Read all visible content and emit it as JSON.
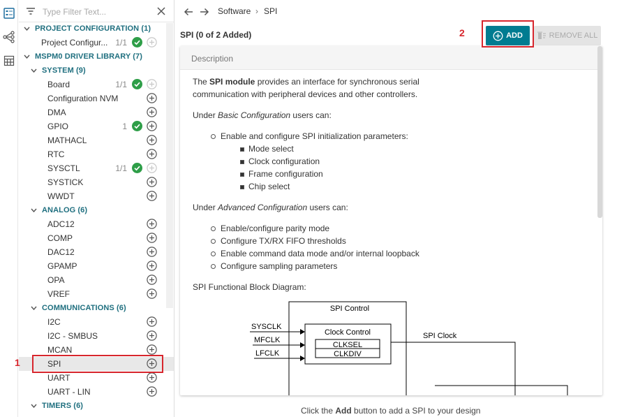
{
  "sidebar": {
    "filter_placeholder": "Type Filter Text...",
    "items": [
      {
        "type": "cat",
        "level": 0,
        "label": "PROJECT CONFIGURATION (1)"
      },
      {
        "type": "item",
        "level": 0,
        "label": "Project Configur...",
        "count": "1/1",
        "check": true,
        "plus_disabled": true
      },
      {
        "type": "cat",
        "level": 0,
        "label": "MSPM0 DRIVER LIBRARY (7)"
      },
      {
        "type": "cat",
        "level": 1,
        "label": "SYSTEM (9)"
      },
      {
        "type": "item",
        "level": 1,
        "label": "Board",
        "count": "1/1",
        "check": true,
        "plus_disabled": true
      },
      {
        "type": "item",
        "level": 1,
        "label": "Configuration NVM",
        "count": "",
        "check": false,
        "plus_disabled": false
      },
      {
        "type": "item",
        "level": 1,
        "label": "DMA",
        "count": "",
        "check": false,
        "plus_disabled": false
      },
      {
        "type": "item",
        "level": 1,
        "label": "GPIO",
        "count": "1",
        "check": true,
        "plus_disabled": false
      },
      {
        "type": "item",
        "level": 1,
        "label": "MATHACL",
        "count": "",
        "check": false,
        "plus_disabled": false
      },
      {
        "type": "item",
        "level": 1,
        "label": "RTC",
        "count": "",
        "check": false,
        "plus_disabled": false
      },
      {
        "type": "item",
        "level": 1,
        "label": "SYSCTL",
        "count": "1/1",
        "check": true,
        "plus_disabled": true
      },
      {
        "type": "item",
        "level": 1,
        "label": "SYSTICK",
        "count": "",
        "check": false,
        "plus_disabled": false
      },
      {
        "type": "item",
        "level": 1,
        "label": "WWDT",
        "count": "",
        "check": false,
        "plus_disabled": false
      },
      {
        "type": "cat",
        "level": 1,
        "label": "ANALOG (6)"
      },
      {
        "type": "item",
        "level": 1,
        "label": "ADC12",
        "count": "",
        "check": false,
        "plus_disabled": false
      },
      {
        "type": "item",
        "level": 1,
        "label": "COMP",
        "count": "",
        "check": false,
        "plus_disabled": false
      },
      {
        "type": "item",
        "level": 1,
        "label": "DAC12",
        "count": "",
        "check": false,
        "plus_disabled": false
      },
      {
        "type": "item",
        "level": 1,
        "label": "GPAMP",
        "count": "",
        "check": false,
        "plus_disabled": false
      },
      {
        "type": "item",
        "level": 1,
        "label": "OPA",
        "count": "",
        "check": false,
        "plus_disabled": false
      },
      {
        "type": "item",
        "level": 1,
        "label": "VREF",
        "count": "",
        "check": false,
        "plus_disabled": false
      },
      {
        "type": "cat",
        "level": 1,
        "label": "COMMUNICATIONS (6)"
      },
      {
        "type": "item",
        "level": 1,
        "label": "I2C",
        "count": "",
        "check": false,
        "plus_disabled": false
      },
      {
        "type": "item",
        "level": 1,
        "label": "I2C - SMBUS",
        "count": "",
        "check": false,
        "plus_disabled": false
      },
      {
        "type": "item",
        "level": 1,
        "label": "MCAN",
        "count": "",
        "check": false,
        "plus_disabled": false
      },
      {
        "type": "item",
        "level": 1,
        "label": "SPI",
        "count": "",
        "check": false,
        "plus_disabled": false,
        "selected": true
      },
      {
        "type": "item",
        "level": 1,
        "label": "UART",
        "count": "",
        "check": false,
        "plus_disabled": false
      },
      {
        "type": "item",
        "level": 1,
        "label": "UART - LIN",
        "count": "",
        "check": false,
        "plus_disabled": false
      },
      {
        "type": "cat",
        "level": 1,
        "label": "TIMERS (6)"
      }
    ]
  },
  "breadcrumb": {
    "parent": "Software",
    "sep": "›",
    "current": "SPI"
  },
  "header": {
    "title": "SPI (0 of 2 Added)",
    "add_label": "ADD",
    "remove_label": "REMOVE ALL"
  },
  "panel": {
    "section": "Description",
    "intro_bold": "SPI module",
    "intro_pre": "The ",
    "intro_post": " provides an interface for synchronous serial",
    "intro_line2": "communication with peripheral devices and other controllers.",
    "basic_pre": "Under ",
    "basic_em": "Basic Configuration",
    "basic_post": " users can:",
    "basic_item": "Enable and configure SPI initialization parameters:",
    "basic_sub": [
      "Mode select",
      "Clock configuration",
      "Frame configuration",
      "Chip select"
    ],
    "adv_pre": "Under ",
    "adv_em": "Advanced Configuration",
    "adv_post": " users can:",
    "adv_items": [
      "Enable/configure parity mode",
      "Configure TX/RX FIFO thresholds",
      "Enable command data mode and/or internal loopback",
      "Configure sampling parameters"
    ],
    "diagram_caption": "SPI Functional Block Diagram:",
    "diagram": {
      "control": "SPI Control",
      "clock_control": "Clock Control",
      "clksel": "CLKSEL",
      "clkdiv": "CLKDIV",
      "inputs": [
        "SYSCLK",
        "MFCLK",
        "LFCLK"
      ],
      "output": "SPI Clock"
    }
  },
  "footer": {
    "pre": "Click the ",
    "bold": "Add",
    "post": " button to add a SPI to your design"
  },
  "annotations": {
    "one": "1",
    "two": "2"
  },
  "colors": {
    "accent": "#007c91",
    "category": "#1f6f7f",
    "check": "#2e9e48",
    "highlight": "#d7262d"
  }
}
